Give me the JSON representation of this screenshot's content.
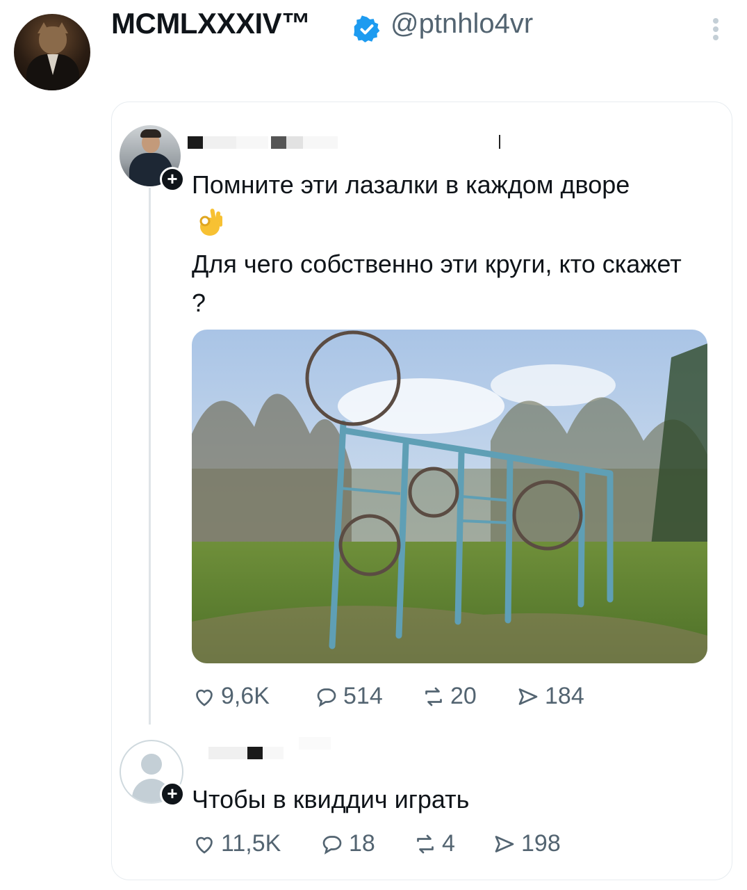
{
  "header": {
    "display_name": "MCMLXXXIV™",
    "handle": "@ptnhlo4vr",
    "verified_color": "#1d9bf0"
  },
  "quoted_tweet": {
    "text_line1": "Помните эти лазалки в каждом дворе",
    "text_line2": "Для чего собственно эти круги, кто скажет ?",
    "emoji": "👌",
    "stats": {
      "likes": "9,6K",
      "replies": "514",
      "retweets": "20",
      "views": "184"
    }
  },
  "reply": {
    "text": "Чтобы в квиддич играть",
    "stats": {
      "likes": "11,5K",
      "replies": "18",
      "retweets": "4",
      "views": "198"
    }
  },
  "icons": {
    "like": "heart-icon",
    "reply": "comment-icon",
    "retweet": "retweet-icon",
    "views": "views-icon",
    "more": "more-vertical-icon",
    "verified": "verified-badge-icon",
    "follow": "plus-icon"
  }
}
